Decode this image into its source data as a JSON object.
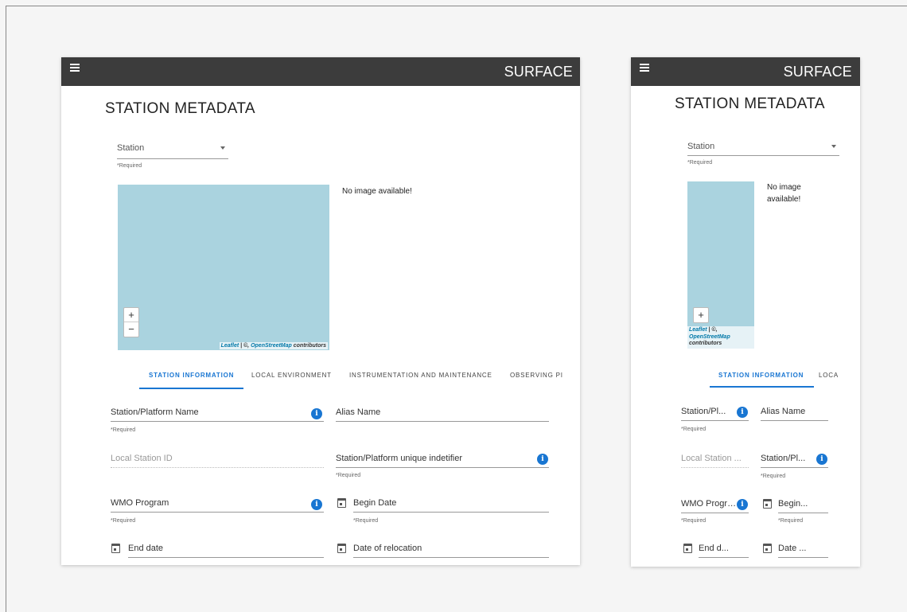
{
  "app": {
    "title": "SURFACE"
  },
  "page": {
    "title": "STATION METADATA"
  },
  "station_select": {
    "label": "Station",
    "hint": "*Required"
  },
  "map": {
    "zoom_in": "+",
    "zoom_out": "−",
    "leaflet": "Leaflet",
    "osm": "OpenStreetMap",
    "contributors": "contributors",
    "sep": " | ©, "
  },
  "image_panel": {
    "message": "No image available!",
    "message_line1": "No image",
    "message_line2": "available!"
  },
  "tabs": [
    "STATION INFORMATION",
    "LOCAL ENVIRONMENT",
    "INSTRUMENTATION AND MAINTENANCE",
    "OBSERVING PI"
  ],
  "tabs_mobile": [
    "STATION INFORMATION",
    "LOCA"
  ],
  "fields": {
    "station_name": {
      "label": "Station/Platform Name",
      "mobile_label": "Station/Pl...",
      "hint": "*Required"
    },
    "alias_name": {
      "label": "Alias Name"
    },
    "local_station_id": {
      "label": "Local Station ID",
      "mobile_label": "Local Station ..."
    },
    "unique_identifier": {
      "label": "Station/Platform unique indetifier",
      "mobile_label": "Station/Pl...",
      "hint": "*Required"
    },
    "wmo_program": {
      "label": "WMO Program",
      "mobile_label": "WMO Program",
      "hint": "*Required"
    },
    "begin_date": {
      "label": "Begin Date",
      "mobile_label": "Begin...",
      "hint": "*Required"
    },
    "end_date": {
      "label": "End date",
      "mobile_label": "End d..."
    },
    "relocation_date": {
      "label": "Date of relocation",
      "mobile_label": "Date ..."
    }
  },
  "icons": {
    "info": "i"
  },
  "colors": {
    "appbar": "#3c3c3c",
    "accent": "#1976d2",
    "map_water": "#aad3df"
  }
}
